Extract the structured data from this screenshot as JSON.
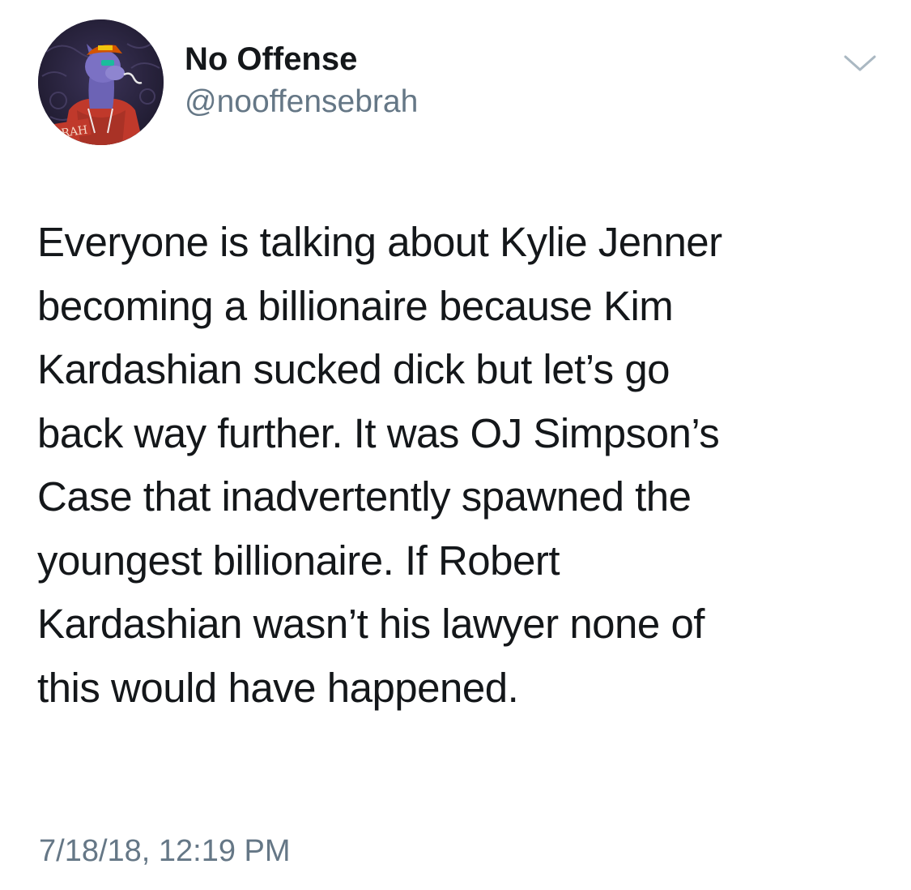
{
  "tweet": {
    "author": {
      "display_name": "No Offense",
      "handle": "@nooffensebrah",
      "avatar_badge_text": "BRAH"
    },
    "text_lines": [
      "Everyone is talking about Kylie Jenner",
      "becoming a billionaire because Kim",
      "Kardashian sucked dick but let’s go",
      "back way further. It was OJ Simpson’s",
      "Case that inadvertently spawned the",
      "youngest billionaire. If Robert",
      "Kardashian wasn’t his lawyer none of",
      "this would have happened."
    ],
    "timestamp": "7/18/18, 12:19 PM",
    "menu_icon": "chevron-down-icon"
  },
  "colors": {
    "text_primary": "#14171a",
    "text_secondary": "#657786",
    "caret": "#aab8c2",
    "background": "#ffffff"
  }
}
